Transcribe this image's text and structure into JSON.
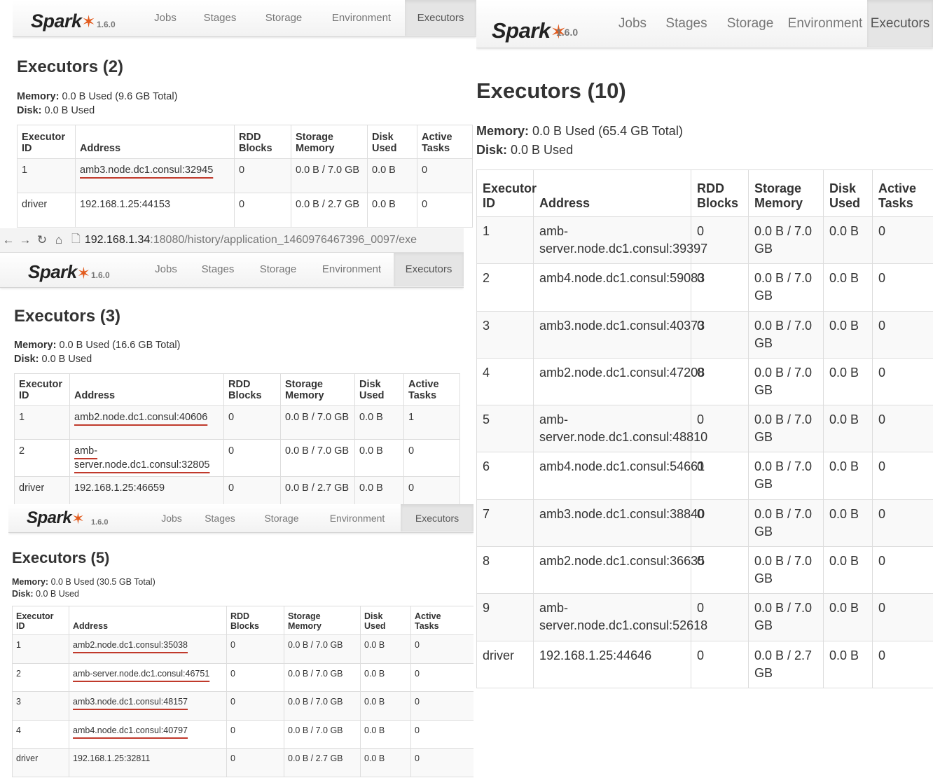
{
  "brand": {
    "name": "Spark",
    "version": "1.6.0",
    "colors": {
      "star": "#e25a1c",
      "active_tab": "#e5e5e5"
    }
  },
  "nav": [
    "Jobs",
    "Stages",
    "Storage",
    "Environment",
    "Executors"
  ],
  "columns": {
    "executor_id_1": "Executor",
    "executor_id_2": "ID",
    "address": "Address",
    "rdd_1": "RDD",
    "rdd_2": "Blocks",
    "storage_1": "Storage",
    "storage_2": "Memory",
    "disk_1": "Disk",
    "disk_2": "Used",
    "active_1": "Active",
    "active_2": "Tasks"
  },
  "browser": {
    "back_icon": "arrow-left-icon",
    "forward_icon": "arrow-right-icon",
    "reload_icon": "reload-icon",
    "home_icon": "home-icon",
    "url_host": "192.168.1.34",
    "url_path": ":18080/history/application_1460976467396_0097/exe"
  },
  "panels": {
    "p2": {
      "title": "Executors (2)",
      "memory_label": "Memory:",
      "memory_value": "0.0 B Used (9.6 GB Total)",
      "disk_label": "Disk:",
      "disk_value": "0.0 B Used",
      "rows": [
        {
          "id": "1",
          "address": "amb3.node.dc1.consul:32945",
          "rdd": "0",
          "storage": "0.0 B / 7.0 GB",
          "disk": "0.0 B",
          "tasks": "0"
        },
        {
          "id": "driver",
          "address": "192.168.1.25:44153",
          "rdd": "0",
          "storage": "0.0 B / 2.7 GB",
          "disk": "0.0 B",
          "tasks": "0"
        }
      ]
    },
    "p3": {
      "title": "Executors (3)",
      "memory_label": "Memory:",
      "memory_value": "0.0 B Used (16.6 GB Total)",
      "disk_label": "Disk:",
      "disk_value": "0.0 B Used",
      "rows": [
        {
          "id": "1",
          "address": "amb2.node.dc1.consul:40606",
          "rdd": "0",
          "storage": "0.0 B / 7.0 GB",
          "disk": "0.0 B",
          "tasks": "1"
        },
        {
          "id": "2",
          "address": "amb-server.node.dc1.consul:32805",
          "rdd": "0",
          "storage": "0.0 B / 7.0 GB",
          "disk": "0.0 B",
          "tasks": "0"
        },
        {
          "id": "driver",
          "address": "192.168.1.25:46659",
          "rdd": "0",
          "storage": "0.0 B / 2.7 GB",
          "disk": "0.0 B",
          "tasks": "0"
        }
      ]
    },
    "p5": {
      "title": "Executors (5)",
      "memory_label": "Memory:",
      "memory_value": "0.0 B Used (30.5 GB Total)",
      "disk_label": "Disk:",
      "disk_value": "0.0 B Used",
      "rows": [
        {
          "id": "1",
          "address": "amb2.node.dc1.consul:35038",
          "rdd": "0",
          "storage": "0.0 B / 7.0 GB",
          "disk": "0.0 B",
          "tasks": "0"
        },
        {
          "id": "2",
          "address": "amb-server.node.dc1.consul:46751",
          "rdd": "0",
          "storage": "0.0 B / 7.0 GB",
          "disk": "0.0 B",
          "tasks": "0"
        },
        {
          "id": "3",
          "address": "amb3.node.dc1.consul:48157",
          "rdd": "0",
          "storage": "0.0 B / 7.0 GB",
          "disk": "0.0 B",
          "tasks": "0"
        },
        {
          "id": "4",
          "address": "amb4.node.dc1.consul:40797",
          "rdd": "0",
          "storage": "0.0 B / 7.0 GB",
          "disk": "0.0 B",
          "tasks": "0"
        },
        {
          "id": "driver",
          "address": "192.168.1.25:32811",
          "rdd": "0",
          "storage": "0.0 B / 2.7 GB",
          "disk": "0.0 B",
          "tasks": "0"
        }
      ]
    },
    "p10": {
      "title": "Executors (10)",
      "memory_label": "Memory:",
      "memory_value": "0.0 B Used (65.4 GB Total)",
      "disk_label": "Disk:",
      "disk_value": "0.0 B Used",
      "rows": [
        {
          "id": "1",
          "address": "amb-server.node.dc1.consul:39397",
          "rdd": "0",
          "storage": "0.0 B / 7.0 GB",
          "disk": "0.0 B",
          "tasks": "0"
        },
        {
          "id": "2",
          "address": "amb4.node.dc1.consul:59083",
          "rdd": "0",
          "storage": "0.0 B / 7.0 GB",
          "disk": "0.0 B",
          "tasks": "0"
        },
        {
          "id": "3",
          "address": "amb3.node.dc1.consul:40373",
          "rdd": "0",
          "storage": "0.0 B / 7.0 GB",
          "disk": "0.0 B",
          "tasks": "0"
        },
        {
          "id": "4",
          "address": "amb2.node.dc1.consul:47208",
          "rdd": "0",
          "storage": "0.0 B / 7.0 GB",
          "disk": "0.0 B",
          "tasks": "0"
        },
        {
          "id": "5",
          "address": "amb-server.node.dc1.consul:48810",
          "rdd": "0",
          "storage": "0.0 B / 7.0 GB",
          "disk": "0.0 B",
          "tasks": "0"
        },
        {
          "id": "6",
          "address": "amb4.node.dc1.consul:54661",
          "rdd": "0",
          "storage": "0.0 B / 7.0 GB",
          "disk": "0.0 B",
          "tasks": "0"
        },
        {
          "id": "7",
          "address": "amb3.node.dc1.consul:38840",
          "rdd": "0",
          "storage": "0.0 B / 7.0 GB",
          "disk": "0.0 B",
          "tasks": "0"
        },
        {
          "id": "8",
          "address": "amb2.node.dc1.consul:36635",
          "rdd": "0",
          "storage": "0.0 B / 7.0 GB",
          "disk": "0.0 B",
          "tasks": "0"
        },
        {
          "id": "9",
          "address": "amb-server.node.dc1.consul:52618",
          "rdd": "0",
          "storage": "0.0 B / 7.0 GB",
          "disk": "0.0 B",
          "tasks": "0"
        },
        {
          "id": "driver",
          "address": "192.168.1.25:44646",
          "rdd": "0",
          "storage": "0.0 B / 2.7 GB",
          "disk": "0.0 B",
          "tasks": "0"
        }
      ]
    }
  }
}
